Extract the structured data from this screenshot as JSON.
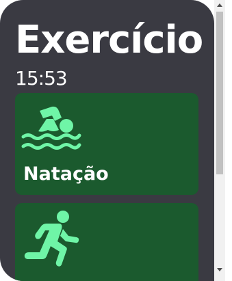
{
  "app": {
    "title": "Exercício",
    "time": "15:53"
  },
  "activities": [
    {
      "label": "Natação",
      "icon": "swimmer-icon"
    },
    {
      "label": "",
      "icon": "runner-icon"
    }
  ],
  "colors": {
    "screen_bg": "#3a3a42",
    "card_bg": "#1b5a2e",
    "icon_color": "#6ff5a7",
    "text": "#ffffff"
  }
}
